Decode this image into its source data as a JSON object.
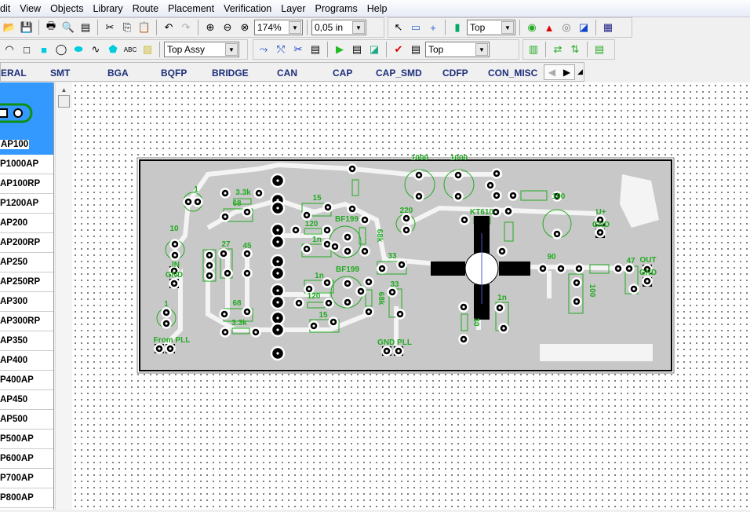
{
  "menu": [
    "dit",
    "View",
    "Objects",
    "Library",
    "Route",
    "Placement",
    "Verification",
    "Layer",
    "Programs",
    "Help"
  ],
  "toolbar1": {
    "zoom": "174%",
    "grid": "0,05 in",
    "layer": "Top"
  },
  "toolbar2": {
    "assy": "Top Assy",
    "layer": "Top"
  },
  "tabs": [
    "ERAL",
    "SMT",
    "BGA",
    "BQFP",
    "BRIDGE",
    "CAN",
    "CAP",
    "CAP_SMD",
    "CDFP",
    "CON_MISC"
  ],
  "library": {
    "selected": "AP100",
    "items": [
      "P1000AP",
      "AP100RP",
      "P1200AP",
      "AP200",
      "AP200RP",
      "AP250",
      "AP250RP",
      "AP300",
      "AP300RP",
      "AP350",
      "AP400",
      "P400AP",
      "AP450",
      "AP500",
      "P500AP",
      "P600AP",
      "P700AP",
      "P800AP"
    ]
  },
  "pcb": {
    "labels": [
      "1",
      "3.3k",
      "68",
      "15",
      "BF199",
      "120",
      "1n",
      "10",
      "27",
      "45",
      "IN",
      "GND",
      "BF199",
      "1n",
      "120",
      "68",
      "3.3k",
      "15",
      "1",
      "From PLL",
      "GND PLL",
      "33",
      "33",
      "68k",
      "68k",
      "1000",
      "1000",
      "220",
      "KT610",
      "100",
      "U+",
      "GND",
      "90",
      "47",
      "OUT",
      "GND",
      "1n",
      "100",
      "30"
    ]
  },
  "colors": {
    "selection": "#3399ff",
    "silkscreen": "#22aa22",
    "board": "#c8c8c8",
    "tab_text": "#1c2e7a"
  }
}
